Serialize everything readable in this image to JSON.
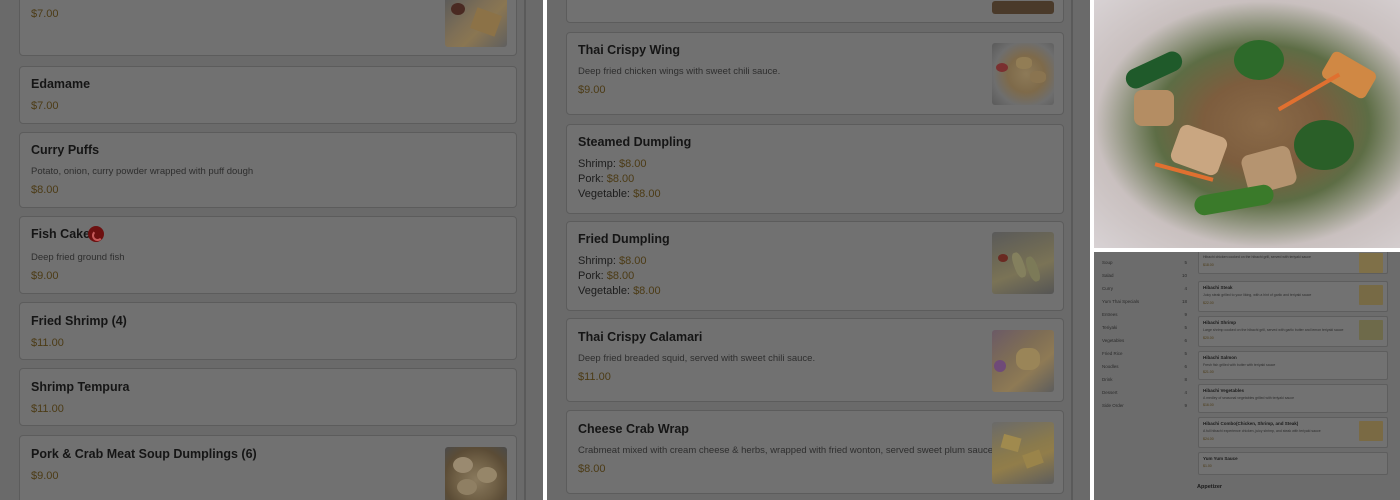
{
  "left_panel": {
    "cards": [
      {
        "name": "",
        "desc": "",
        "price": "$7.00",
        "thumb": "fried-pancake-photo"
      },
      {
        "name": "Edamame",
        "desc": "",
        "price": "$7.00"
      },
      {
        "name": "Curry Puffs",
        "desc": "Potato, onion, curry powder wrapped with puff dough",
        "price": "$8.00"
      },
      {
        "name": "Fish Cake",
        "desc": "Deep fried ground fish",
        "price": "$9.00",
        "badge": "spicy-icon"
      },
      {
        "name": "Fried Shrimp (4)",
        "desc": "",
        "price": "$11.00"
      },
      {
        "name": "Shrimp Tempura",
        "desc": "",
        "price": "$11.00"
      },
      {
        "name": "Pork & Crab Meat Soup Dumplings (6)",
        "desc": "",
        "price": "$9.00",
        "thumb": "soup-dumplings-photo"
      }
    ]
  },
  "mid_panel": {
    "cards": [
      {
        "name": "",
        "desc": "",
        "price": "",
        "thumb": "partial-photo"
      },
      {
        "name": "Thai Crispy Wing",
        "desc": "Deep fried chicken wings with sweet chili sauce.",
        "price": "$9.00",
        "thumb": "chicken-wings-photo"
      },
      {
        "name": "Steamed Dumpling",
        "options": [
          {
            "label": "Shrimp:",
            "price": "$8.00"
          },
          {
            "label": "Pork:",
            "price": "$8.00"
          },
          {
            "label": "Vegetable:",
            "price": "$8.00"
          }
        ]
      },
      {
        "name": "Fried Dumpling",
        "thumb": "fried-dumplings-photo",
        "options": [
          {
            "label": "Shrimp:",
            "price": "$8.00"
          },
          {
            "label": "Pork:",
            "price": "$8.00"
          },
          {
            "label": "Vegetable:",
            "price": "$8.00"
          }
        ]
      },
      {
        "name": "Thai Crispy Calamari",
        "desc": "Deep fried breaded squid, served with sweet chili sauce.",
        "price": "$11.00",
        "thumb": "calamari-photo"
      },
      {
        "name": "Cheese Crab Wrap",
        "desc": "Crabmeat mixed with cream cheese & herbs, wrapped with fried wonton, served sweet plum sauce.",
        "price": "$8.00",
        "thumb": "crab-wrap-photo"
      }
    ]
  },
  "right_panel": {
    "photo": "stir-fried-noodles-photo",
    "mini": {
      "categories": [
        {
          "label": "Soup",
          "count": "5"
        },
        {
          "label": "Salad",
          "count": "10"
        },
        {
          "label": "Curry",
          "count": "4"
        },
        {
          "label": "Yum Thai Specials",
          "count": "18"
        },
        {
          "label": "Entrees",
          "count": "9"
        },
        {
          "label": "Teriyaki",
          "count": "5"
        },
        {
          "label": "Vegetables",
          "count": "6"
        },
        {
          "label": "Fried Rice",
          "count": "5"
        },
        {
          "label": "Noodles",
          "count": "6"
        },
        {
          "label": "Drink",
          "count": "8"
        },
        {
          "label": "Dessert",
          "count": "4"
        },
        {
          "label": "Side Order",
          "count": "9"
        }
      ],
      "cards": [
        {
          "name": "",
          "desc": "Hibachi chicken cooked on the hibachi grill, served with teriyaki sauce",
          "price": "$18.00",
          "thumb": true
        },
        {
          "name": "Hibachi Steak",
          "desc": "Juicy steak grilled to your liking, with a hint of garlic and teriyaki sauce",
          "price": "$22.00",
          "thumb": true
        },
        {
          "name": "Hibachi Shrimp",
          "desc": "Large shrimp cooked on the hibachi grill, served with garlic butter and lemon teriyaki sauce",
          "price": "$20.00",
          "thumb": true
        },
        {
          "name": "Hibachi Salmon",
          "desc": "Fresh fish grilled with butter with teriyaki sauce",
          "price": "$21.00",
          "thumb": false
        },
        {
          "name": "Hibachi Vegetables",
          "desc": "A medley of seasonal vegetables grilled with teriyaki sauce",
          "price": "$16.00",
          "thumb": false
        },
        {
          "name": "Hibachi Combo(Chicken, Shrimp, and Steak)",
          "desc": "A full hibachi experience chicken, juicy shrimp, and steak with teriyaki sauce",
          "price": "$24.00",
          "thumb": true
        },
        {
          "name": "Yum Yum Sauce",
          "desc": "",
          "price": "$1.00",
          "thumb": false
        }
      ],
      "section": "Appetizer"
    }
  },
  "colors": {
    "overlay": "#6b6b6b",
    "card": "#717171",
    "price": "#4c3b15",
    "spicy": "#6d1010"
  }
}
